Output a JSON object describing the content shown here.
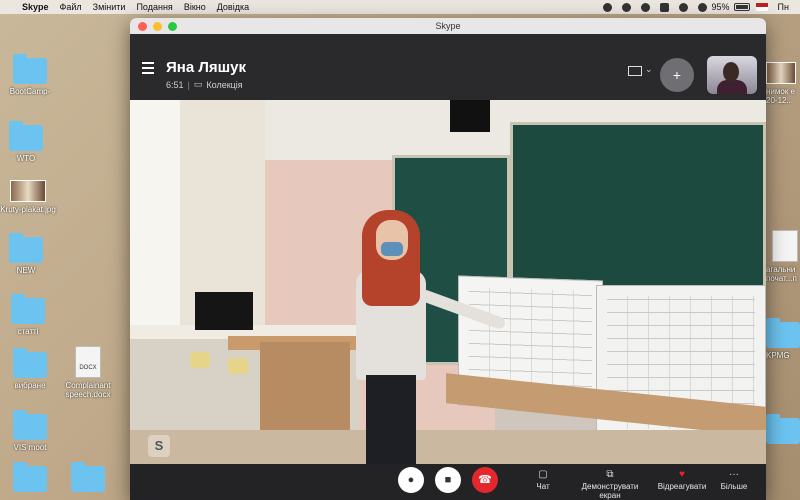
{
  "menubar": {
    "app_name": "Skype",
    "menu": [
      "Файл",
      "Змінити",
      "Подання",
      "Вікно",
      "Довідка"
    ],
    "battery": "95%",
    "clock": "Пн"
  },
  "desktop": {
    "left_icons": [
      {
        "label": "BootCamp-",
        "kind": "folder"
      },
      {
        "label": "WTO",
        "kind": "folder"
      },
      {
        "label": "Kruty-plakat.jpg",
        "kind": "image"
      },
      {
        "label": "NEW",
        "kind": "folder"
      },
      {
        "label": "статті",
        "kind": "folder"
      },
      {
        "label": "вибране",
        "kind": "folder"
      },
      {
        "label": "VIS moot",
        "kind": "folder"
      }
    ],
    "doc_icon": {
      "label": "Complainant speech.docx",
      "badge": "DOCX"
    },
    "right_icons": [
      {
        "label": "нимок е 20-12..."
      },
      {
        "label": "агальни почат...п"
      },
      {
        "label": "KPMG"
      }
    ]
  },
  "skype": {
    "window_title": "Skype",
    "contact_name": "Яна Ляшук",
    "call_duration": "6:51",
    "collection_label": "Колекція",
    "controls": {
      "chat": "Чат",
      "share_screen": "Демонструвати екран",
      "react": "Відреагувати",
      "more": "Більше"
    }
  }
}
